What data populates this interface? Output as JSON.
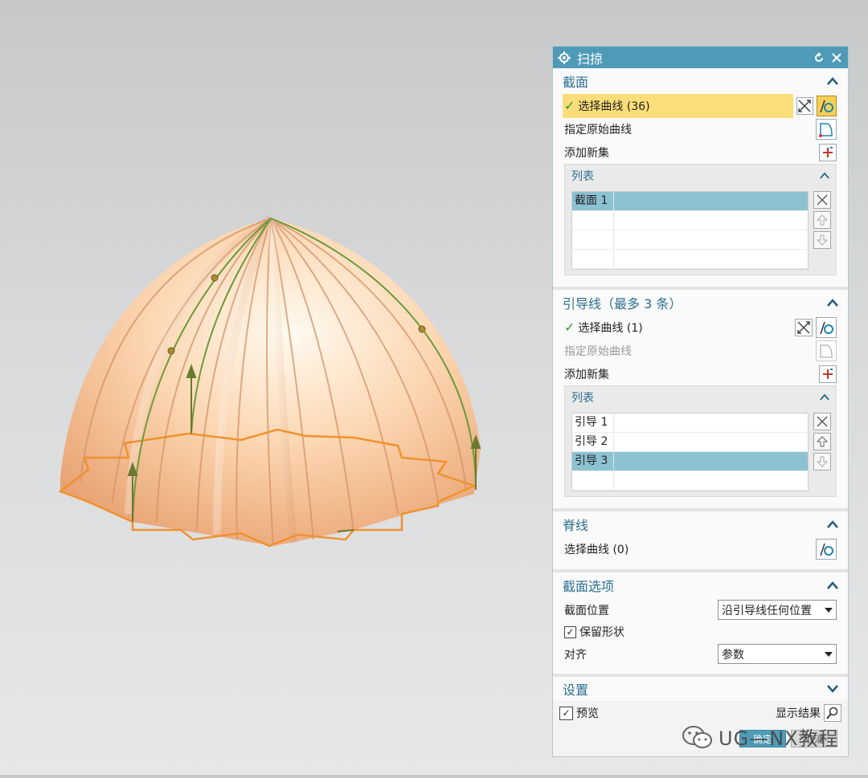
{
  "dialog": {
    "title": "扫掠",
    "sections": {
      "section": {
        "title": "截面",
        "select_curve": "选择曲线 (36)",
        "specify_original": "指定原始曲线",
        "add_new_set": "添加新集",
        "list_title": "列表",
        "list_items": [
          "截面 1",
          "",
          "",
          ""
        ]
      },
      "guide": {
        "title": "引导线（最多 3 条）",
        "select_curve": "选择曲线 (1)",
        "specify_original": "指定原始曲线",
        "add_new_set": "添加新集",
        "list_title": "列表",
        "list_items": [
          "引导 1",
          "引导 2",
          "引导 3",
          ""
        ]
      },
      "spine": {
        "title": "脊线",
        "select_curve": "选择曲线 (0)"
      },
      "section_options": {
        "title": "截面选项",
        "position_label": "截面位置",
        "position_value": "沿引导线任何位置",
        "preserve_shape": "保留形状",
        "alignment_label": "对齐",
        "alignment_value": "参数"
      },
      "settings": {
        "title": "设置"
      }
    },
    "preview_label": "预览",
    "show_result_label": "显示结果",
    "ok_button": "确定",
    "cancel_button": "取消"
  },
  "watermark": "UG—NX教程",
  "colors": {
    "titlebar": "#4f9bb7",
    "selected_row": "#8dc2d3",
    "active_selection": "#fbde79",
    "model_fill": "#f9c69c",
    "curve_orange": "#f0922e",
    "guide_green": "#6a9a3a"
  }
}
